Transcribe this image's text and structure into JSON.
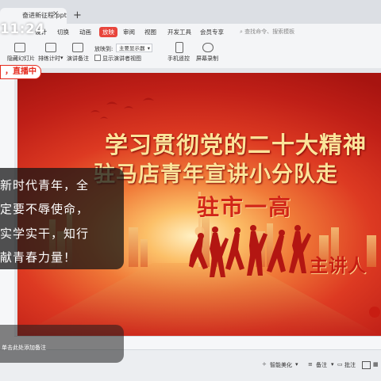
{
  "window": {
    "tab_title": "奋进新征程.pptx",
    "clock": "11:24"
  },
  "menu": {
    "items": [
      "设计",
      "切换",
      "动画",
      "放映",
      "审阅",
      "视图",
      "开发工具",
      "会员专享"
    ],
    "active": "放映",
    "search_placeholder": "查找命令、搜索模板"
  },
  "ribbon": {
    "hide_slide": "隐藏幻灯片",
    "rehearse": "排练计时",
    "notes": "演讲备注",
    "play_to_label": "放映到:",
    "monitor_value": "主要显示器",
    "show_presenter_view": "显示演讲者视图",
    "phone_remote": "手机遥控",
    "screen_record": "屏幕录制"
  },
  "live_badge": "，直播中",
  "slide": {
    "title": "学习贯彻党的二十大精神",
    "subtitle": "驻马店青年宣讲小分队走",
    "school": "驻市一高",
    "presenter": "主讲人"
  },
  "caption_overlay": {
    "lines": [
      "新时代青年，全",
      "定要不辱使命，",
      "实学实干，知行",
      "献青春力量！"
    ]
  },
  "notes": {
    "placeholder": "单击此处添加备注"
  },
  "statusbar": {
    "smart_beautify": "智能美化",
    "notes_btn": "备注",
    "comment_btn": "批注"
  },
  "colors": {
    "accent": "#e8453c",
    "slide_title": "#fbe49a",
    "slide_red": "#bf1f17"
  }
}
